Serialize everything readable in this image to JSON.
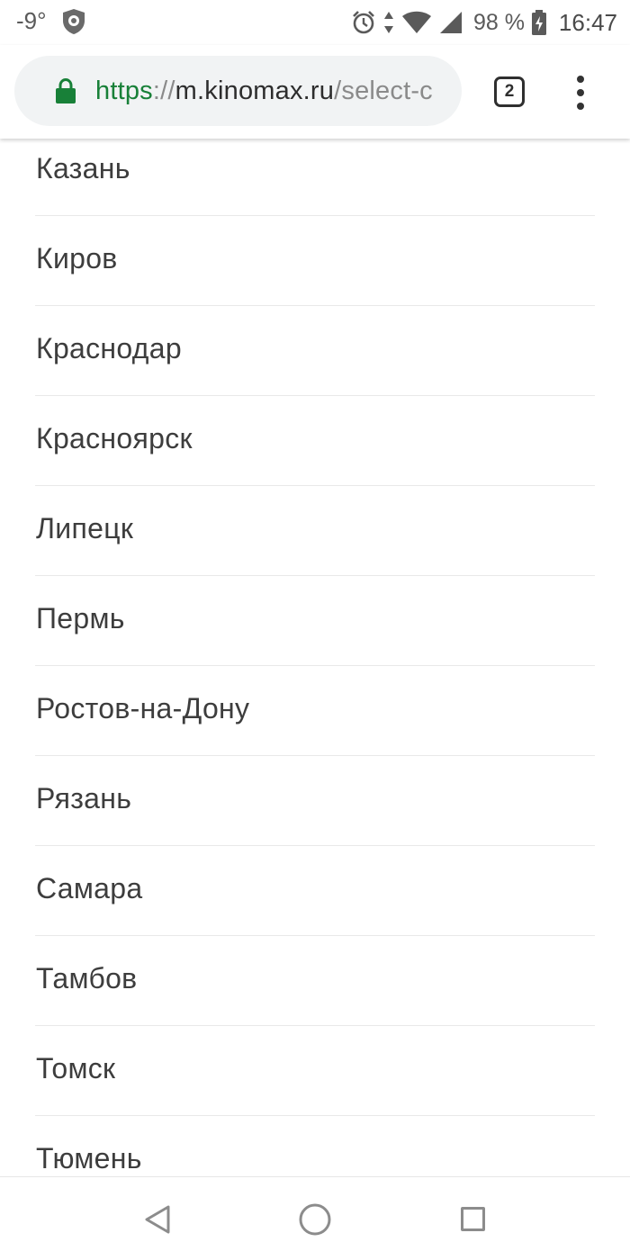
{
  "status_bar": {
    "temperature": "-9°",
    "battery_percent": "98 %",
    "time": "16:47",
    "icons": [
      "shield-icon",
      "alarm-icon",
      "data-arrows-icon",
      "wifi-icon",
      "signal-icon",
      "battery-charging-icon"
    ]
  },
  "browser": {
    "url_scheme": "https",
    "url_separator": "://",
    "url_host": "m.kinomax.ru",
    "url_path": "/select-c",
    "tab_count": "2",
    "secure_color": "#188038"
  },
  "cities": [
    {
      "label": "Казань"
    },
    {
      "label": "Киров"
    },
    {
      "label": "Краснодар"
    },
    {
      "label": "Красноярск"
    },
    {
      "label": "Липецк"
    },
    {
      "label": "Пермь"
    },
    {
      "label": "Ростов-на-Дону"
    },
    {
      "label": "Рязань"
    },
    {
      "label": "Самара"
    },
    {
      "label": "Тамбов"
    },
    {
      "label": "Томск"
    },
    {
      "label": "Тюмень"
    }
  ],
  "nav_bar": {
    "icons": [
      "back-icon",
      "home-icon",
      "recents-icon"
    ]
  }
}
